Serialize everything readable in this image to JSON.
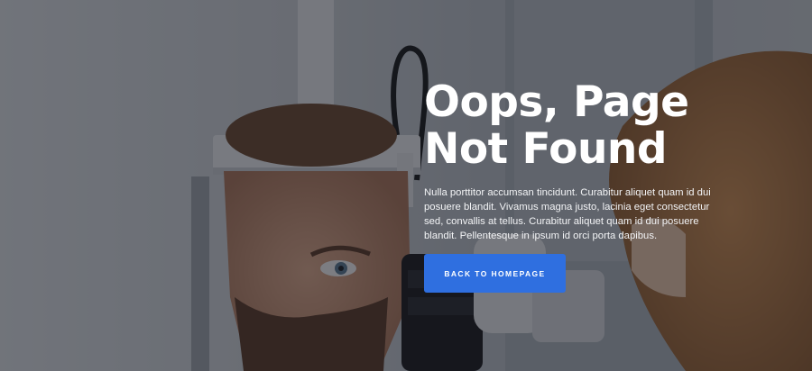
{
  "hero": {
    "background_image": "eye-exam-photo",
    "title_line_1": "Oops, Page",
    "title_line_2": "Not Found",
    "description": "Nulla porttitor accumsan tincidunt. Curabitur aliquet quam id dui posuere blandit. Vivamus magna justo, lacinia eget consectetur sed, convallis at tellus. Curabitur aliquet quam id dui posuere blandit. Pellentesque in ipsum id orci porta dapibus.",
    "button_label": "BACK TO HOMEPAGE"
  },
  "colors": {
    "overlay": "#12141a",
    "button": "#2f6fe0",
    "text": "#ffffff"
  }
}
